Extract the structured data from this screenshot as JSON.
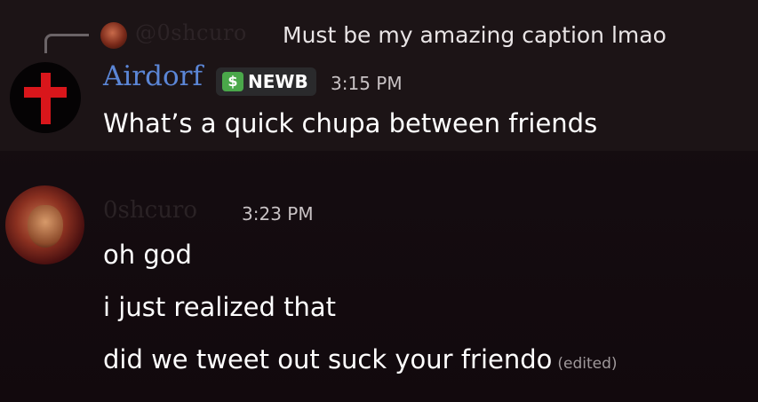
{
  "reply": {
    "author": "@0shcuro",
    "text": "Must be my amazing caption lmao"
  },
  "message1": {
    "author": "Airdorf",
    "badge": {
      "icon": "dollar-icon",
      "label": "NEWB",
      "color": "#4aa84a"
    },
    "time": "3:15 PM",
    "content": "What’s a quick chupa between friends",
    "author_color": "#5b86d6"
  },
  "message2": {
    "author": "0shcuro",
    "time": "3:23 PM",
    "lines": [
      "oh god",
      "i just realized that",
      "did we tweet out suck your friendo"
    ],
    "edited_label": "(edited)"
  }
}
